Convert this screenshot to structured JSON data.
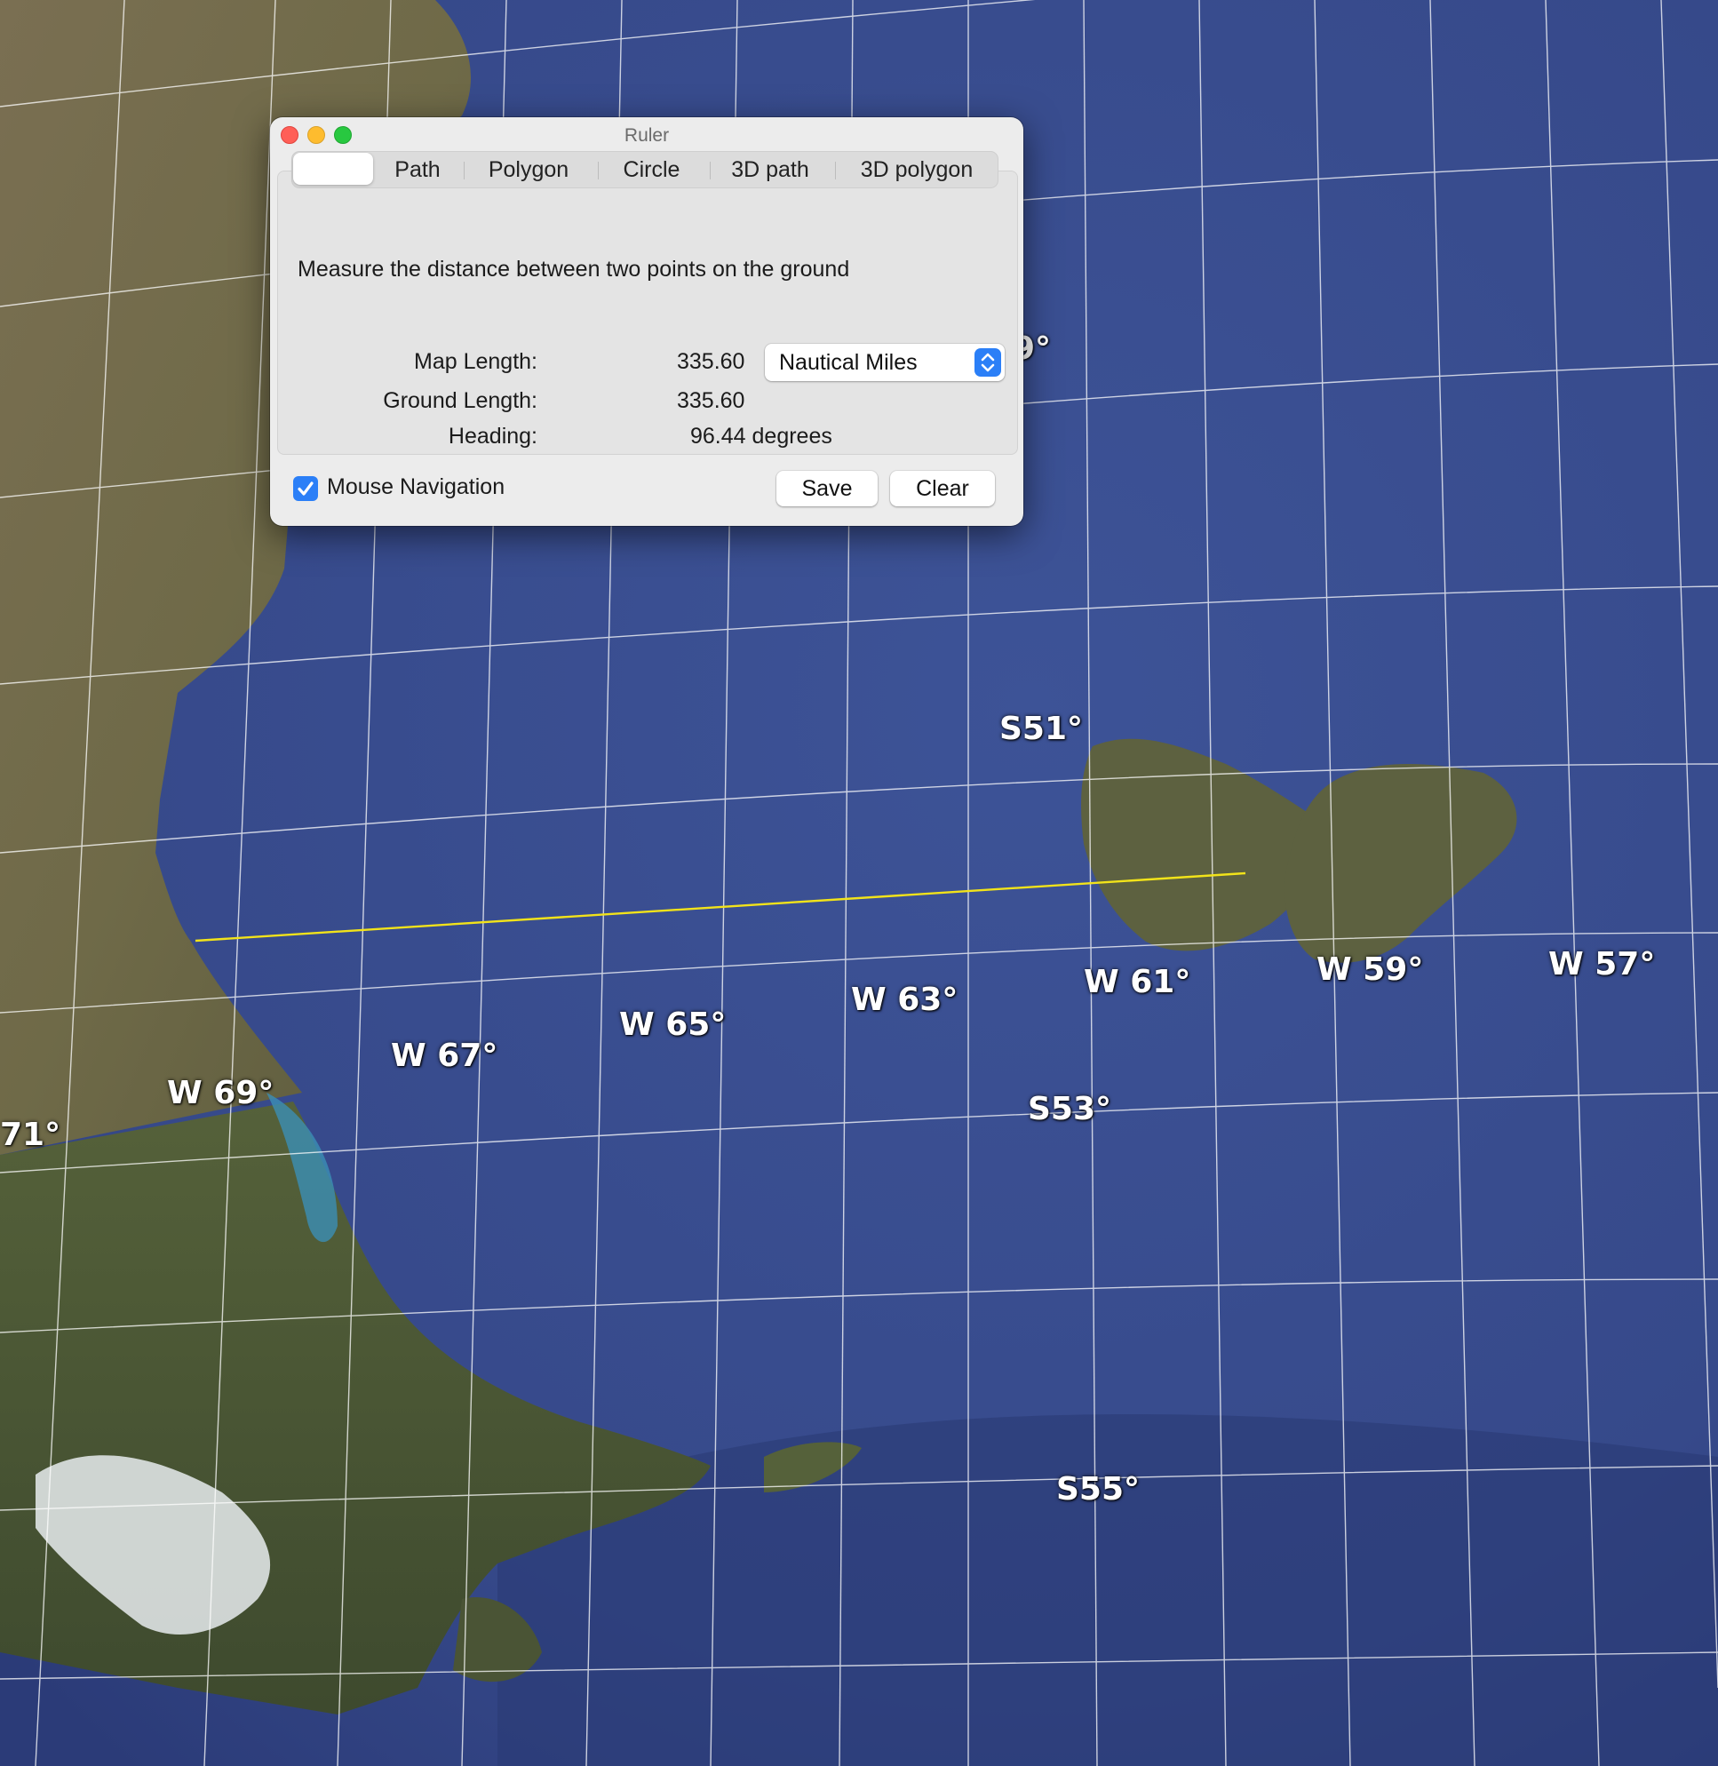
{
  "map": {
    "grid_labels": {
      "w57": "W 57°",
      "w59": "W 59°",
      "w61": "W 61°",
      "w63": "W 63°",
      "w65": "W 65°",
      "w67": "W 67°",
      "w69": "W 69°",
      "w71": "71°",
      "s49": "9°",
      "s51": "S51°",
      "s53": "S53°",
      "s55": "S55°"
    },
    "colors": {
      "ocean": "#3a4f8f",
      "land": "#6f6a48",
      "measure_line": "#f2e31a",
      "grid": "#ffffff"
    }
  },
  "ruler": {
    "title": "Ruler",
    "tabs": {
      "line": "",
      "path": "Path",
      "polygon": "Polygon",
      "circle": "Circle",
      "path3d": "3D path",
      "polygon3d": "3D polygon"
    },
    "description": "Measure the distance between two points on the ground",
    "map_length_label": "Map Length:",
    "map_length_value": "335.60",
    "ground_length_label": "Ground Length:",
    "ground_length_value": "335.60",
    "heading_label": "Heading:",
    "heading_value": "96.44 degrees",
    "unit_selected": "Nautical Miles",
    "mouse_navigation_label": "Mouse Navigation",
    "mouse_navigation_checked": true,
    "save_label": "Save",
    "clear_label": "Clear"
  }
}
